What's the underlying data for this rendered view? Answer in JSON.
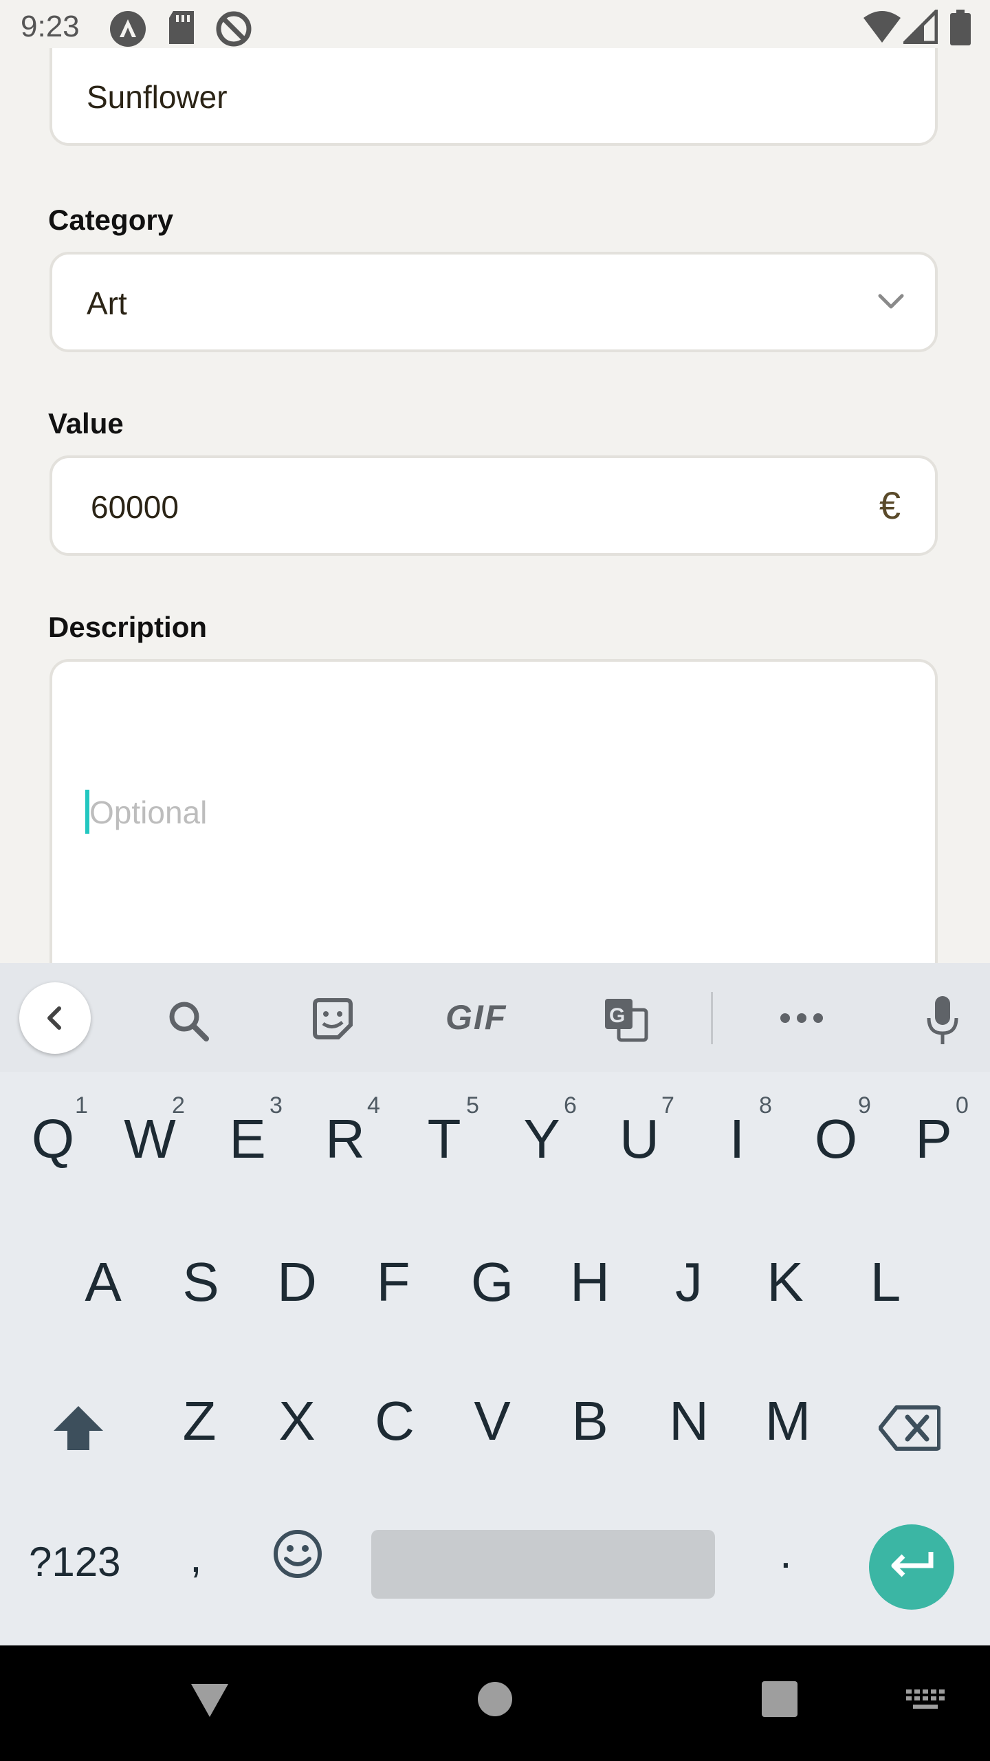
{
  "status_bar": {
    "time": "9:23"
  },
  "form": {
    "name_value": "Sunflower",
    "category_label": "Category",
    "category_value": "Art",
    "value_label": "Value",
    "value_value": "60000",
    "currency_symbol": "€",
    "description_label": "Description",
    "description_placeholder": "Optional"
  },
  "keyboard": {
    "toolbar": {
      "gif_label": "GIF",
      "icons": [
        "back-icon",
        "search-icon",
        "sticker-icon",
        "gif-icon",
        "translate-icon",
        "more-icon",
        "mic-icon"
      ]
    },
    "row1": [
      {
        "key": "Q",
        "num": "1"
      },
      {
        "key": "W",
        "num": "2"
      },
      {
        "key": "E",
        "num": "3"
      },
      {
        "key": "R",
        "num": "4"
      },
      {
        "key": "T",
        "num": "5"
      },
      {
        "key": "Y",
        "num": "6"
      },
      {
        "key": "U",
        "num": "7"
      },
      {
        "key": "I",
        "num": "8"
      },
      {
        "key": "O",
        "num": "9"
      },
      {
        "key": "P",
        "num": "0"
      }
    ],
    "row2": [
      "A",
      "S",
      "D",
      "F",
      "G",
      "H",
      "J",
      "K",
      "L"
    ],
    "row3": [
      "Z",
      "X",
      "C",
      "V",
      "B",
      "N",
      "M"
    ],
    "row4": {
      "symbols": "?123",
      "comma": ",",
      "period": "."
    }
  },
  "colors": {
    "accent": "#22c7c0",
    "enter_button": "#3bb6a4",
    "background": "#f3f2ef"
  }
}
